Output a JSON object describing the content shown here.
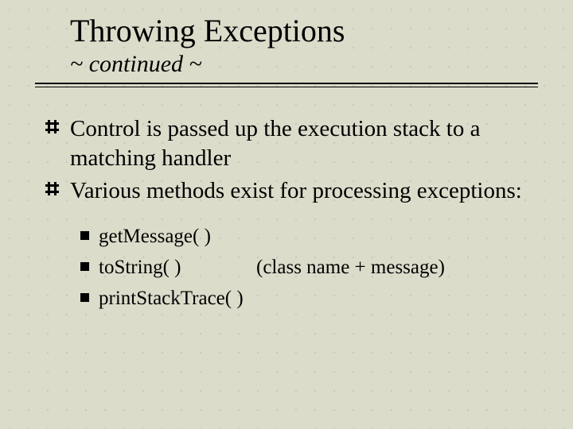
{
  "title": "Throwing Exceptions",
  "subtitle": "~ continued ~",
  "bullets": [
    {
      "text": "Control is passed up the execution stack to a matching handler"
    },
    {
      "text": "Various methods exist for processing exceptions:"
    }
  ],
  "sub_bullets": [
    {
      "label": "getMessage( )",
      "note": ""
    },
    {
      "label": "toString( )",
      "note": "(class name + message)"
    },
    {
      "label": "printStackTrace( )",
      "note": ""
    }
  ]
}
